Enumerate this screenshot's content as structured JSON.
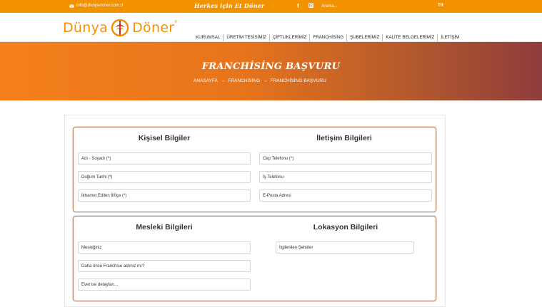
{
  "topbar": {
    "email": "info@dunyadoner.com.tr",
    "slogan": "Herkes için Et Döner",
    "facebook_icon": "f",
    "search_placeholder": "Arama...",
    "language": "TR"
  },
  "header": {
    "logo_word1": "Dünya",
    "logo_word2": "Döner",
    "logo_reg": "®",
    "nav": [
      "KURUMSAL",
      "ÜRETİM TESİSİMİZ",
      "ÇİFTLİKLERİMİZ",
      "FRANCHİSİNG",
      "ŞUBELERİMİZ",
      "KALİTE BELGELERİMİZ",
      "İLETİŞİM"
    ]
  },
  "hero": {
    "title": "FRANCHİSİNG BAŞVURU",
    "breadcrumb": [
      "ANASAYFA",
      "FRANCHİSİNG",
      "FRANCHİSİNG BAŞVURU"
    ],
    "separator": "→"
  },
  "form": {
    "personal": {
      "title": "Kişisel Bilgiler",
      "fields": [
        "Adı - Soyadı (*)",
        "Doğum Tarihi (*)",
        "İkhamet Edilen İl/İlçe (*)"
      ]
    },
    "contact": {
      "title": "İletişim Bilgileri",
      "fields": [
        "Cep Telefonu (*)",
        "İş Telefonu",
        "E-Posta Adresi"
      ]
    },
    "professional": {
      "title": "Mesleki Bilgileri",
      "fields": [
        "Mesleğiniz",
        "Daha önce Franchise aldınız mı?",
        "Evet ise detayları..."
      ]
    },
    "location": {
      "title": "Lokasyon Bilgileri",
      "fields": [
        "İlgilenilen Şehirler"
      ]
    }
  },
  "colors": {
    "brand": "#f39200",
    "hero_end": "#8f3c3c",
    "box_border": "#b98563"
  },
  "icons": [
    "envelope-icon",
    "facebook-icon",
    "instagram-icon",
    "logo-flame-mark"
  ]
}
